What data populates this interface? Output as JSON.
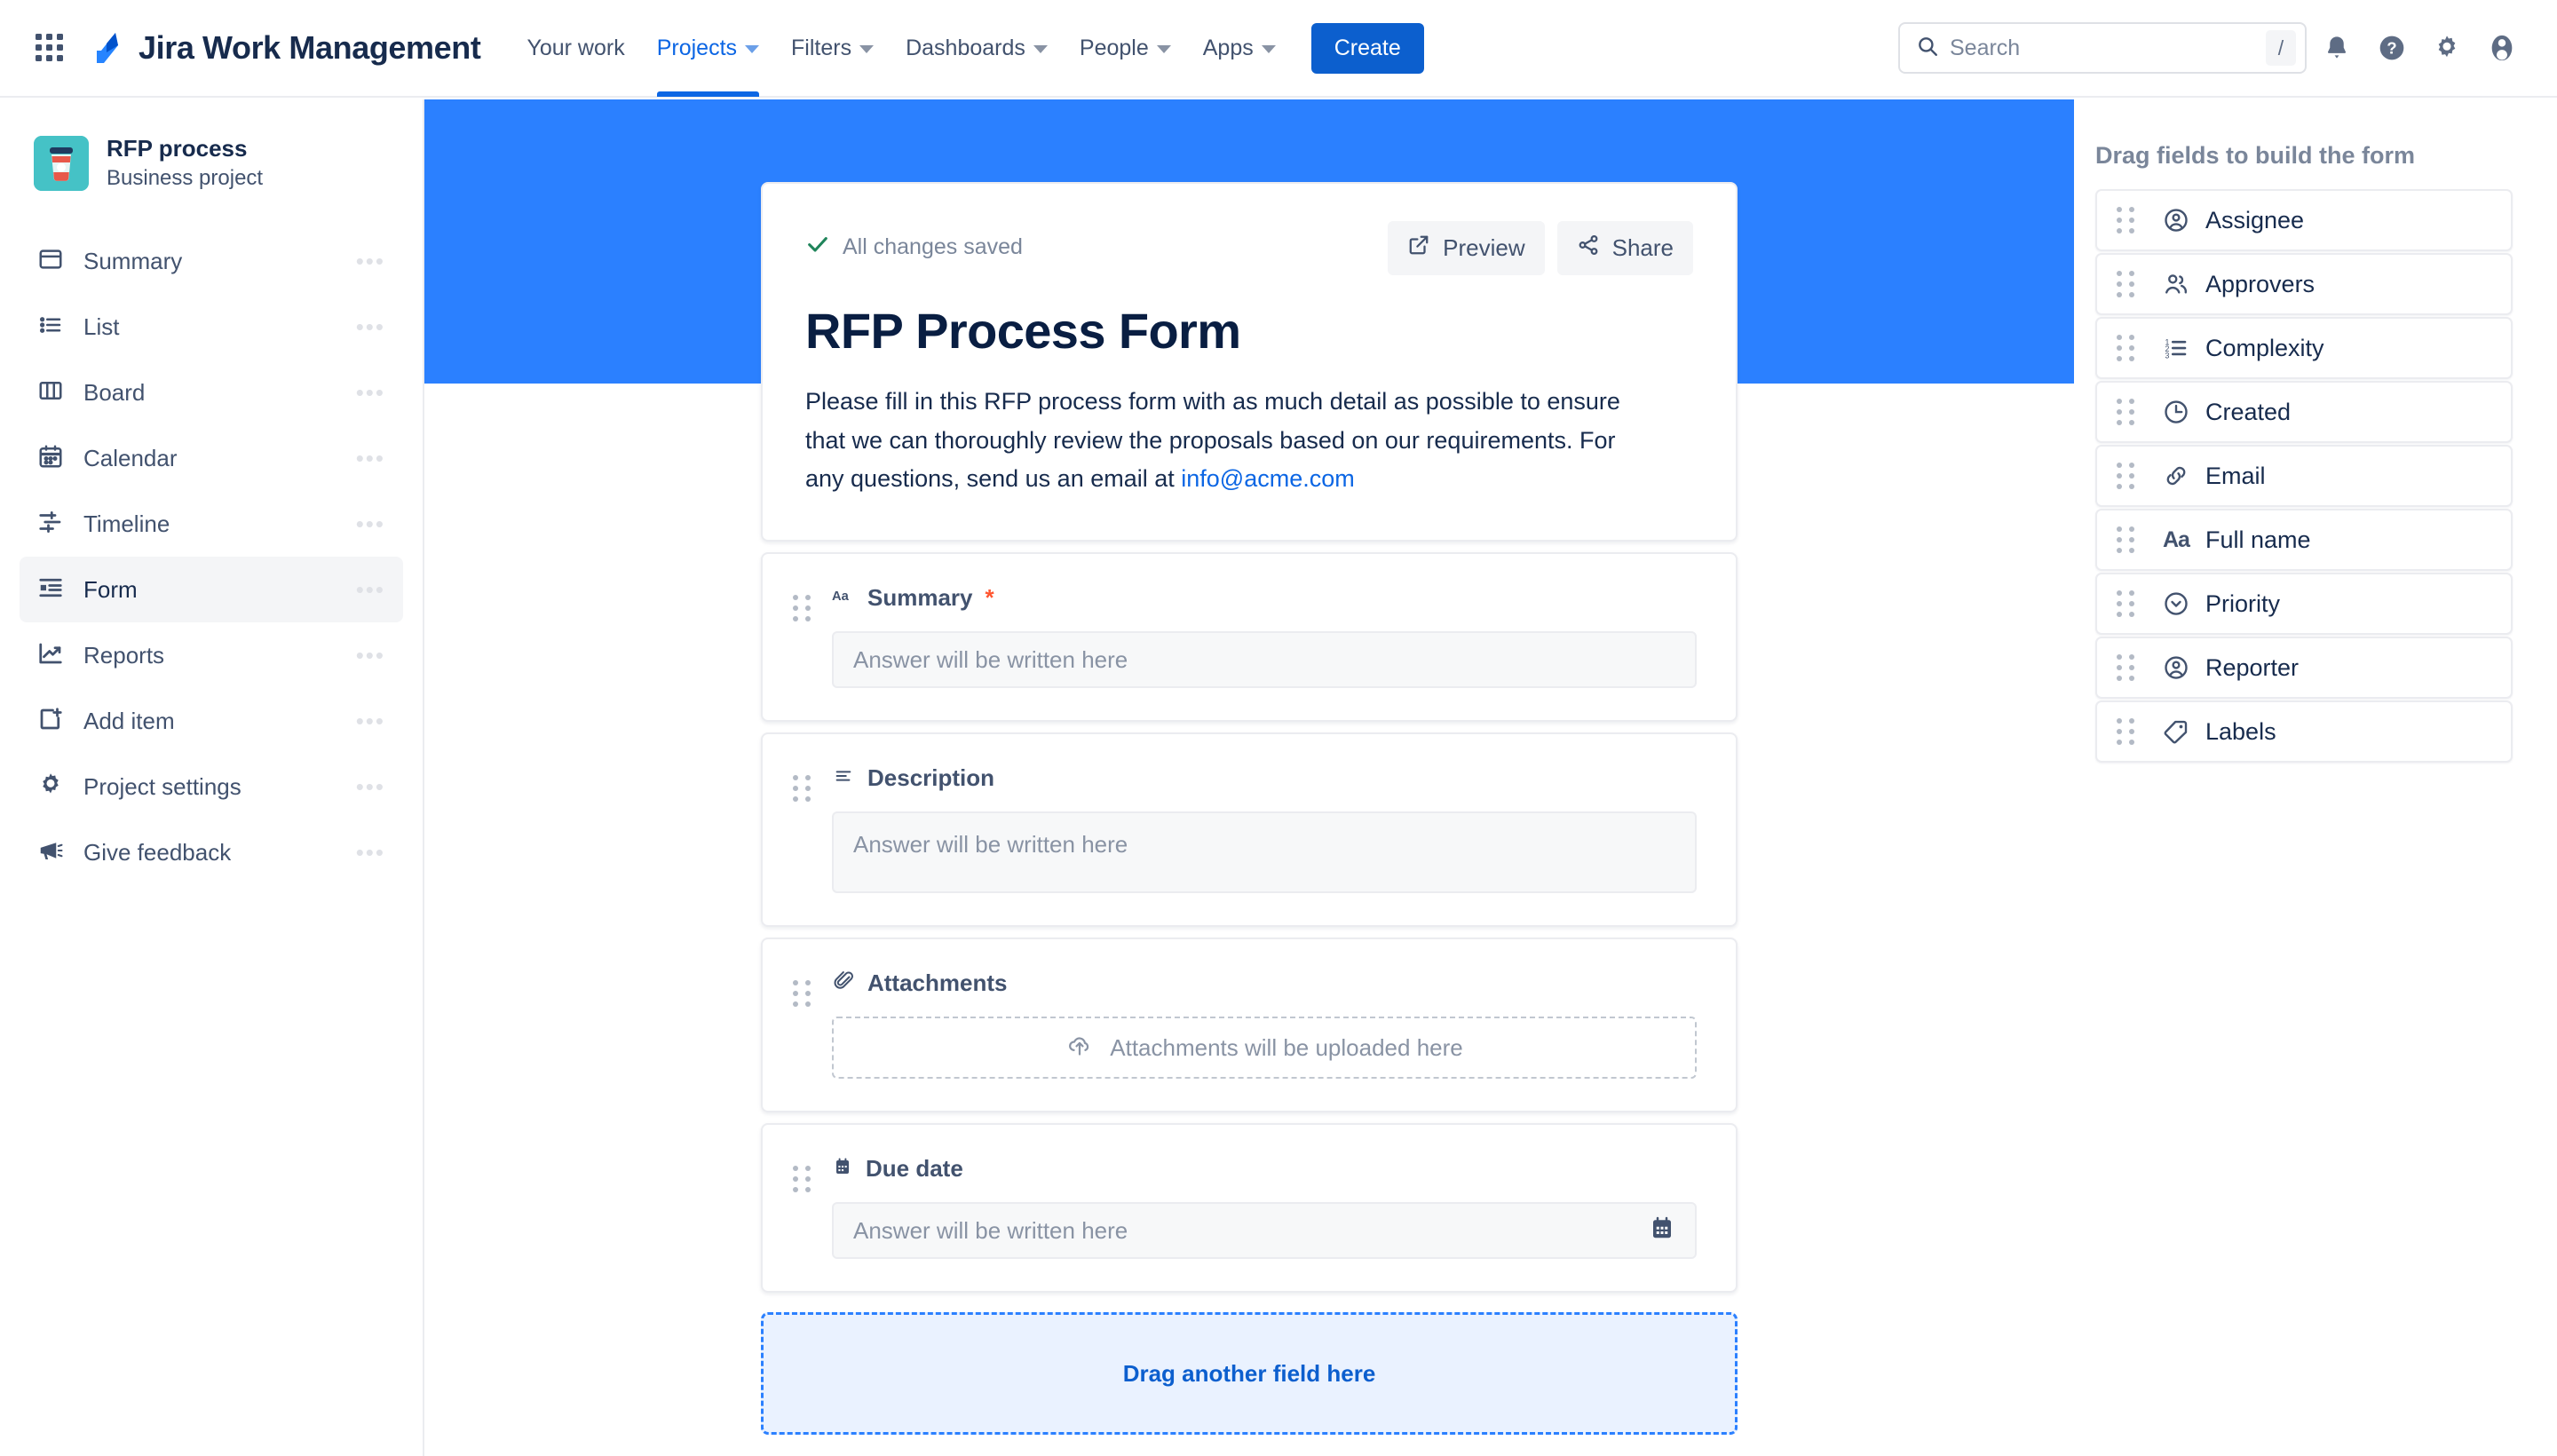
{
  "topnav": {
    "app_switcher_icon": "grid-apps-icon",
    "brand": "Jira Work Management",
    "links": [
      {
        "label": "Your work",
        "has_caret": false,
        "active": false
      },
      {
        "label": "Projects",
        "has_caret": true,
        "active": true
      },
      {
        "label": "Filters",
        "has_caret": true,
        "active": false
      },
      {
        "label": "Dashboards",
        "has_caret": true,
        "active": false
      },
      {
        "label": "People",
        "has_caret": true,
        "active": false
      },
      {
        "label": "Apps",
        "has_caret": true,
        "active": false
      }
    ],
    "create_label": "Create",
    "search": {
      "placeholder": "Search",
      "value": "",
      "shortcut": "/"
    },
    "icons": [
      "notifications-bell-icon",
      "help-question-icon",
      "settings-gear-icon",
      "user-avatar-icon"
    ]
  },
  "sidebar": {
    "project": {
      "name": "RFP process",
      "type": "Business project",
      "avatar_icon": "coffee-cup-icon",
      "avatar_color": "#45c2c6"
    },
    "items": [
      {
        "label": "Summary",
        "icon": "summary-panel-icon",
        "active": false
      },
      {
        "label": "List",
        "icon": "list-icon",
        "active": false
      },
      {
        "label": "Board",
        "icon": "board-columns-icon",
        "active": false
      },
      {
        "label": "Calendar",
        "icon": "calendar-icon",
        "active": false
      },
      {
        "label": "Timeline",
        "icon": "timeline-icon",
        "active": false
      },
      {
        "label": "Form",
        "icon": "form-icon",
        "active": true
      },
      {
        "label": "Reports",
        "icon": "reports-chart-icon",
        "active": false
      },
      {
        "label": "Add item",
        "icon": "add-item-icon",
        "active": false
      },
      {
        "label": "Project settings",
        "icon": "settings-gear-icon",
        "active": false
      },
      {
        "label": "Give feedback",
        "icon": "megaphone-icon",
        "active": false
      }
    ],
    "overflow_dots": "•••"
  },
  "form": {
    "saved_status": "All changes saved",
    "saved_icon": "checkmark-icon",
    "preview_label": "Preview",
    "preview_icon": "external-link-icon",
    "share_label": "Share",
    "share_icon": "share-nodes-icon",
    "title": "RFP Process Form",
    "description_before": "Please fill in this RFP process form with as much detail as possible to ensure that we can thoroughly review the proposals based on our requirements. For any questions, send us an email at ",
    "description_link": "info@acme.com",
    "fields": [
      {
        "label": "Summary",
        "icon": "text-aa-icon",
        "required": true,
        "required_mark": "*",
        "input_type": "text",
        "placeholder": "Answer will be written here"
      },
      {
        "label": "Description",
        "icon": "paragraph-lines-icon",
        "required": false,
        "required_mark": "",
        "input_type": "textarea",
        "placeholder": "Answer will be written here"
      },
      {
        "label": "Attachments",
        "icon": "paperclip-icon",
        "required": false,
        "required_mark": "",
        "input_type": "upload",
        "placeholder": "Attachments will be uploaded here",
        "upload_icon": "cloud-upload-icon"
      },
      {
        "label": "Due date",
        "icon": "due-date-calendar-icon",
        "required": false,
        "required_mark": "",
        "input_type": "date",
        "placeholder": "Answer will be written here",
        "trailing_icon": "calendar-picker-icon"
      }
    ],
    "drop_target_label": "Drag another field here"
  },
  "right_panel": {
    "title": "Drag fields to build the form",
    "fields": [
      {
        "label": "Assignee",
        "icon": "person-circle-icon"
      },
      {
        "label": "Approvers",
        "icon": "people-group-icon"
      },
      {
        "label": "Complexity",
        "icon": "numbered-list-icon"
      },
      {
        "label": "Created",
        "icon": "clock-icon"
      },
      {
        "label": "Email",
        "icon": "link-chain-icon"
      },
      {
        "label": "Full name",
        "icon": "text-aa-icon"
      },
      {
        "label": "Priority",
        "icon": "priority-chevron-circle-icon"
      },
      {
        "label": "Reporter",
        "icon": "person-circle-icon"
      },
      {
        "label": "Labels",
        "icon": "tag-icon"
      }
    ]
  },
  "colors": {
    "accent_blue": "#0c66e4",
    "banner_blue": "#2b80ff",
    "create_blue": "#0c5fce",
    "required_red": "#ff5630",
    "saved_green": "#1f845a",
    "avatar_teal": "#45c2c6"
  }
}
